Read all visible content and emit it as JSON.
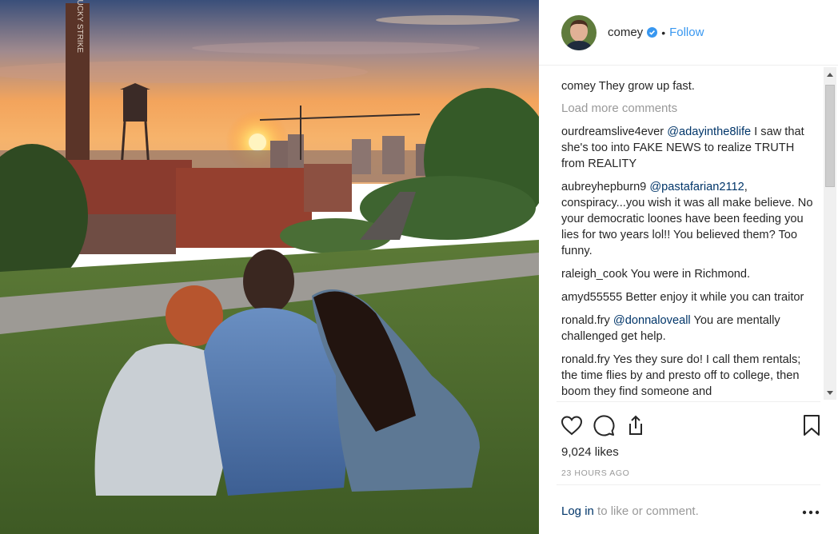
{
  "photo": {
    "alt_subject": "family watching sunset over city"
  },
  "photo_sign": {
    "chimney_text": "LUCKY STRIKE"
  },
  "header": {
    "username": "comey",
    "separator": "•",
    "follow_label": "Follow",
    "verified_icon": "verified-badge-icon"
  },
  "caption": {
    "username": "comey",
    "text": "They grow up fast."
  },
  "load_more_label": "Load more comments",
  "comments": [
    {
      "username": "ourdreamslive4ever",
      "mention": "@adayinthe8life",
      "text": " I saw that she's too into FAKE NEWS to realize TRUTH from REALITY"
    },
    {
      "username": "aubreyhepburn9",
      "mention": "@pastafarian2112",
      "text": ", conspiracy...you wish it was all make believe. No your democratic loones have been feeding you lies for two years lol!! You believed them? Too funny."
    },
    {
      "username": "raleigh_cook",
      "mention": "",
      "text": "You were in Richmond."
    },
    {
      "username": "amyd55555",
      "mention": "",
      "text": "Better enjoy it while you can traitor"
    },
    {
      "username": "ronald.fry",
      "mention": "@donnaloveall",
      "text": " You are mentally challenged get help."
    },
    {
      "username": "ronald.fry",
      "mention": "",
      "text": "Yes they sure do! I call them rentals; the time flies by and presto off to college, then boom they find someone and"
    }
  ],
  "likes": "9,024 likes",
  "timestamp": "23 HOURS AGO",
  "footer": {
    "login_link": "Log in",
    "login_rest": " to like or comment."
  },
  "icons": {
    "like": "heart-icon",
    "comment": "comment-bubble-icon",
    "share": "share-upload-icon",
    "save": "bookmark-icon",
    "more": "more-options-icon"
  },
  "colors": {
    "link_blue": "#3897f0",
    "mention_navy": "#003569",
    "muted_gray": "#999999",
    "text": "#262626"
  }
}
